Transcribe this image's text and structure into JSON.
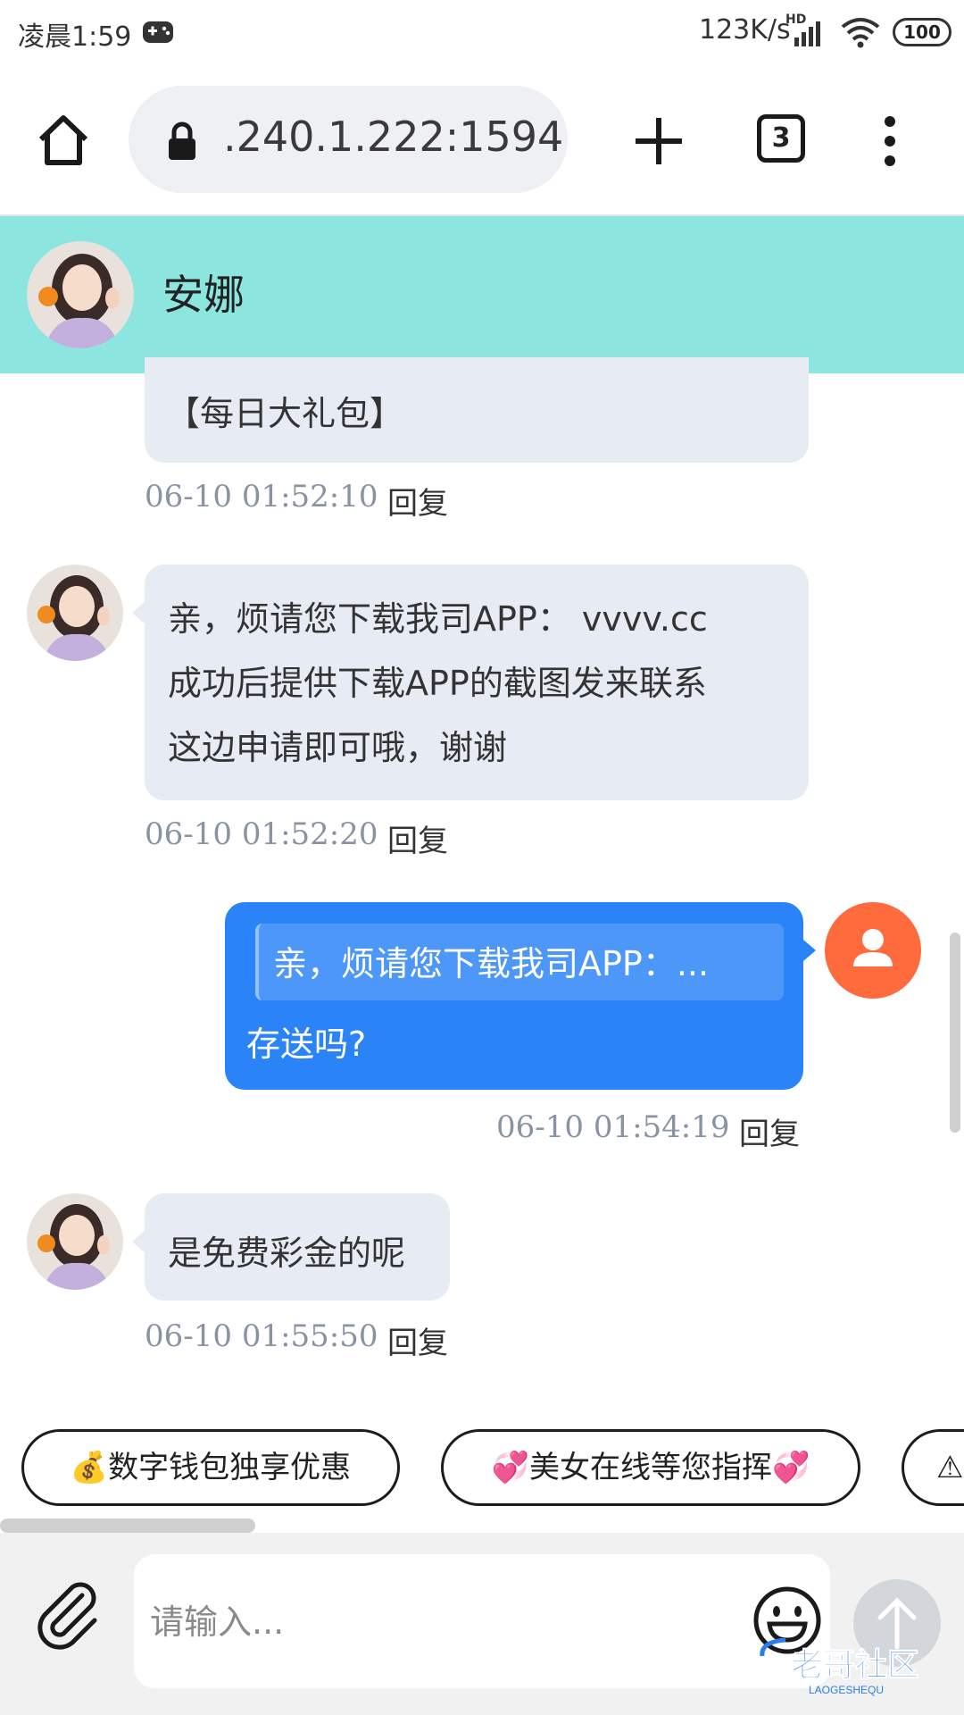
{
  "status_bar": {
    "time": "凌晨1:59",
    "net_speed": "123K/s",
    "hd": "HD",
    "battery": "100"
  },
  "browser": {
    "url": ".240.1.222:1594",
    "tab_count": "3"
  },
  "chat": {
    "contact_name": "安娜",
    "messages": [
      {
        "side": "in",
        "text": "【每日大礼包】",
        "timestamp": "06-10 01:52:10",
        "reply": "回复"
      },
      {
        "side": "in",
        "lines": [
          "亲，烦请您下载我司APP： vvvv.cc",
          "成功后提供下载APP的截图发来联系",
          "这边申请即可哦，谢谢"
        ],
        "timestamp": "06-10 01:52:20",
        "reply": "回复"
      },
      {
        "side": "out",
        "quote": "亲，烦请您下载我司APP：...",
        "text": "存送吗?",
        "timestamp": "06-10 01:54:19",
        "reply": "回复"
      },
      {
        "side": "in",
        "text": "是免费彩金的呢",
        "timestamp": "06-10 01:55:50",
        "reply": "回复"
      }
    ]
  },
  "quick_replies": [
    "💰数字钱包独享优惠",
    "💞美女在线等您指挥💞",
    "⚠"
  ],
  "input": {
    "placeholder": "请输入..."
  },
  "watermark": {
    "title": "老哥社区",
    "sub": "LAOGESHEQU"
  },
  "colors": {
    "header_bg": "#8ce6df",
    "bubble_in": "#e7ebf3",
    "bubble_out": "#2a84f7",
    "user_avatar": "#ff6b3d"
  },
  "icons": [
    "game-controller-icon",
    "signal-icon",
    "wifi-icon",
    "home-icon",
    "lock-icon",
    "plus-icon",
    "more-vertical-icon",
    "user-icon",
    "paperclip-icon",
    "smiley-icon",
    "arrow-up-icon"
  ]
}
